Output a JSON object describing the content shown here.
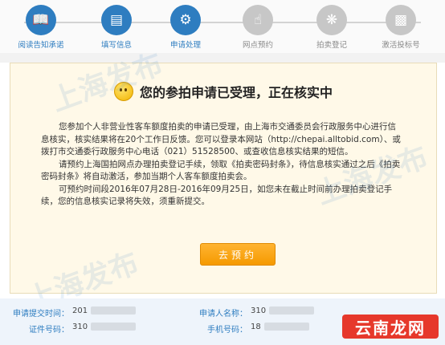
{
  "steps": [
    {
      "label": "阅读告知承诺",
      "icon": "book-icon",
      "status": "done"
    },
    {
      "label": "填写信息",
      "icon": "form-icon",
      "status": "done"
    },
    {
      "label": "申请处理",
      "icon": "gears-icon",
      "status": "done"
    },
    {
      "label": "网点预约",
      "icon": "hand-pointer-icon",
      "status": "todo"
    },
    {
      "label": "拍卖登记",
      "icon": "network-icon",
      "status": "todo"
    },
    {
      "label": "激活投标号",
      "icon": "id-card-icon",
      "status": "todo"
    }
  ],
  "status_title": "您的参拍申请已受理，正在核实中",
  "body": {
    "p1": "您参加个人非营业性客车额度拍卖的申请已受理，由上海市交通委员会行政服务中心进行信息核实，核实结果将在20个工作日反馈。您可以登录本网站（http://chepai.alltobid.com）、或拨打市交通委行政服务中心电话（021）51528500、或查收信息核实结果的短信。",
    "p2": "请预约上海国拍网点办理拍卖登记手续，领取《拍卖密码封条》，待信息核实通过之后《拍卖密码封条》将自动激活，参加当期个人客车额度拍卖会。",
    "p3": "可预约时间段2016年07月28日-2016年09月25日，如您未在截止时间前办理拍卖登记手续，您的信息核实记录将失效，须重新提交。"
  },
  "button_label": "去预约",
  "info": {
    "submit_time_label": "申请提交时间：",
    "submit_time_value": "201",
    "id_label": "证件号码：",
    "id_value": "310",
    "applicant_label": "申请人名称：",
    "applicant_value": "310",
    "phone_label": "手机号码：",
    "phone_value": "18"
  },
  "watermark": "上海发布",
  "logo_text": "云南龙网",
  "colors": {
    "accent": "#2e7dc0",
    "button": "#f7a21b",
    "card_bg": "#fff9e8",
    "logo": "#e6382b"
  }
}
